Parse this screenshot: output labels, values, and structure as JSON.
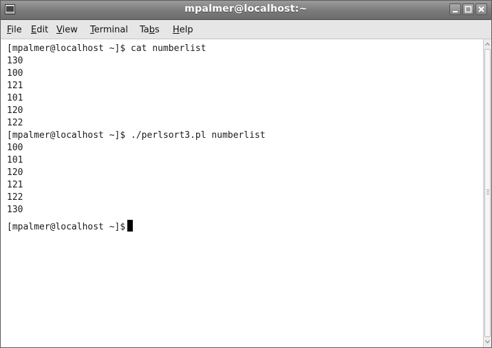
{
  "window": {
    "title": "mpalmer@localhost:~",
    "controls": {
      "minimize": "minimize-icon",
      "maximize": "maximize-icon",
      "close": "close-icon"
    }
  },
  "menubar": [
    {
      "pre": "",
      "u": "F",
      "post": "ile"
    },
    {
      "pre": "",
      "u": "E",
      "post": "dit"
    },
    {
      "pre": "",
      "u": "V",
      "post": "iew"
    },
    {
      "pre": "",
      "u": "T",
      "post": "erminal"
    },
    {
      "pre": "Ta",
      "u": "b",
      "post": "s"
    },
    {
      "pre": "",
      "u": "H",
      "post": "elp"
    }
  ],
  "terminal": {
    "lines": [
      "[mpalmer@localhost ~]$ cat numberlist",
      "130",
      "100",
      "121",
      "101",
      "120",
      "122",
      "[mpalmer@localhost ~]$ ./perlsort3.pl numberlist",
      "100",
      "101",
      "120",
      "121",
      "122",
      "130",
      "[mpalmer@localhost ~]$"
    ]
  },
  "colors": {
    "titlebar": "#7a7a7a",
    "menubar": "#e6e6e6",
    "terminal_bg": "#ffffff",
    "text": "#1a1a1a"
  }
}
